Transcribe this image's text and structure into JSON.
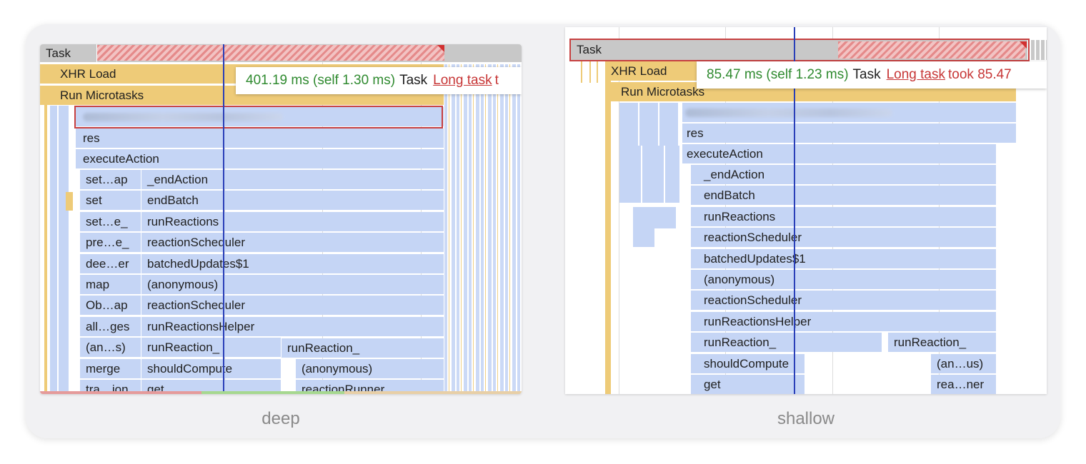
{
  "deep": {
    "caption": "deep",
    "task_label": "Task",
    "xhr_label": "XHR Load",
    "micro_label": "Run Microtasks",
    "res_label": "res",
    "execute_label": "executeAction",
    "left_column": [
      "set…ap",
      "set",
      "set…e_",
      "pre…e_",
      "dee…er",
      "map",
      "Ob…ap",
      "all…ges",
      "(an…s)",
      "merge",
      "tra…ion"
    ],
    "right_column": [
      "_endAction",
      "endBatch",
      "runReactions",
      "reactionScheduler",
      "batchedUpdates$1",
      "(anonymous)",
      "reactionScheduler",
      "runReactionsHelper",
      "runReaction_",
      "shouldCompute",
      "get"
    ],
    "extra": {
      "run_reaction_2": "runReaction_",
      "anonymous_2": "(anonymous)",
      "reaction_runner": "reactionRunner"
    },
    "tooltip": {
      "duration": "401.19 ms (self 1.30 ms)",
      "task": "Task",
      "link": "Long task",
      "rest": "t"
    }
  },
  "shallow": {
    "caption": "shallow",
    "task_label": "Task",
    "xhr_label": "XHR Load",
    "micro_label": "Run Microtasks",
    "res_label": "res",
    "execute_label": "executeAction",
    "stack": [
      "_endAction",
      "endBatch",
      "runReactions",
      "reactionScheduler",
      "batchedUpdates$1",
      "(anonymous)",
      "reactionScheduler",
      "runReactionsHelper",
      "runReaction_",
      "shouldCompute",
      "get"
    ],
    "extra": {
      "run_reaction_2": "runReaction_",
      "anon_us": "(an…us)",
      "rea_ner": "rea…ner"
    },
    "tooltip": {
      "duration": "85.47 ms (self 1.23 ms)",
      "task": "Task",
      "link": "Long task",
      "rest": "took 85.47"
    }
  },
  "colors": {
    "frame_blue": "#c5d5f5",
    "frame_gold": "#eecb78",
    "long_task_red": "#c73636",
    "cursor": "#2a3fb8"
  }
}
